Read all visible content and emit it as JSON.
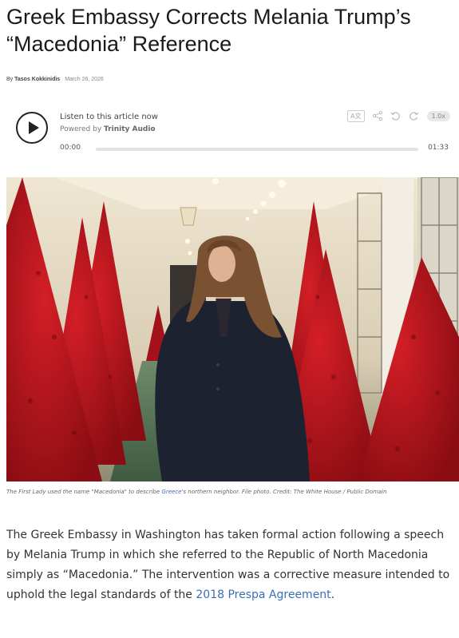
{
  "article": {
    "title": "Greek Embassy Corrects Melania Trump’s “Macedonia” Reference",
    "byline_prefix": "By ",
    "author": "Tasos Kokkinidis",
    "date": "March 26, 2026"
  },
  "audio_player": {
    "title": "Listen to this article now",
    "powered_prefix": "Powered by ",
    "powered_brand": "Trinity Audio",
    "time_current": "00:00",
    "time_total": "01:33",
    "progress": 0,
    "speed_label": "1.0x",
    "tool_icons": [
      "translate-icon",
      "share-icon",
      "rewind-icon",
      "forward-icon"
    ]
  },
  "image": {
    "caption_before_link": "The First Lady used the name \"Macedonia\" to describe ",
    "caption_link": "Greece",
    "caption_after_link": "'s northern neighbor. File photo. Credit: The White House / Public Domain"
  },
  "body": {
    "paragraph_text": "The Greek Embassy in Washington has taken formal action following a speech by Melania Trump in which she referred to the Republic of North Macedonia simply as “Macedonia.” The intervention was a corrective measure intended to uphold the legal standards of the ",
    "paragraph_link": "2018 Prespa Agreement",
    "paragraph_end": "."
  },
  "colors": {
    "link": "#3a6fb5",
    "tree_red": "#b3141c",
    "coat": "#1d2230"
  }
}
